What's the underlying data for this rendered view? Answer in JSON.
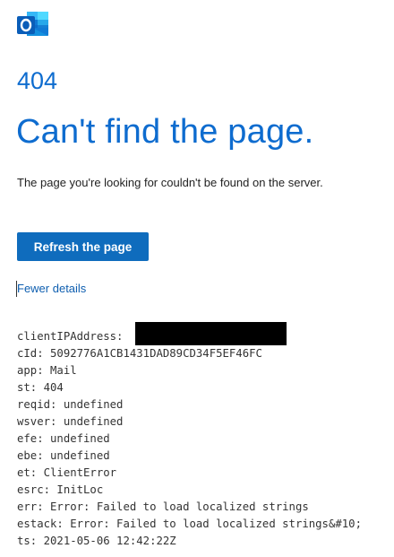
{
  "app": {
    "logo_icon": "outlook-logo-icon",
    "brand_color": "#0f6cbd"
  },
  "error": {
    "code": "404",
    "title": "Can't find the page.",
    "description": "The page you're looking for couldn't be found on the server."
  },
  "actions": {
    "refresh_label": "Refresh the page",
    "toggle_details_label": "Fewer details"
  },
  "details": [
    {
      "key": "clientIPAddress",
      "text": "clientIPAddress: ",
      "redacted": true
    },
    {
      "key": "cId",
      "text": "cId: 5092776A1CB1431DAD89CD34F5EF46FC"
    },
    {
      "key": "app",
      "text": "app: Mail"
    },
    {
      "key": "st",
      "text": "st: 404"
    },
    {
      "key": "reqid",
      "text": "reqid: undefined"
    },
    {
      "key": "wsver",
      "text": "wsver: undefined"
    },
    {
      "key": "efe",
      "text": "efe: undefined"
    },
    {
      "key": "ebe",
      "text": "ebe: undefined"
    },
    {
      "key": "et",
      "text": "et: ClientError"
    },
    {
      "key": "esrc",
      "text": "esrc: InitLoc"
    },
    {
      "key": "err",
      "text": "err: Error: Failed to load localized strings"
    },
    {
      "key": "estack",
      "text": "estack: Error: Failed to load localized strings&#10;"
    },
    {
      "key": "ts",
      "text": "ts: 2021-05-06 12:42:22Z"
    }
  ]
}
